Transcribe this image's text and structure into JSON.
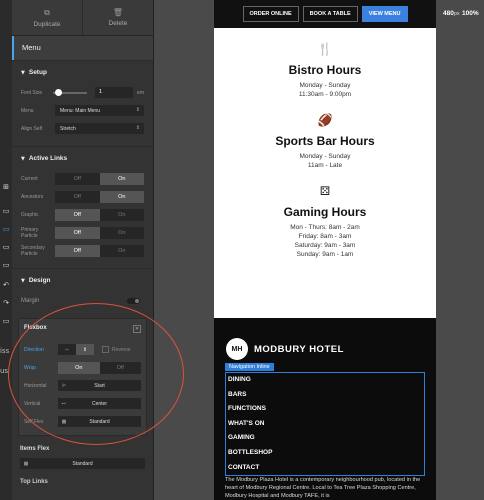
{
  "toolbar": {
    "duplicate": "Duplicate",
    "delete": "Delete"
  },
  "panel_title": "Menu",
  "gutter_texts": [
    "iss",
    "us"
  ],
  "setup": {
    "title": "Setup",
    "font_size_label": "Font Size",
    "font_size_value": "1",
    "font_size_unit": "em",
    "menu_label": "Menu",
    "menu_value": "Menu: Main Menu",
    "align_self_label": "Align Self",
    "align_self_value": "Stretch"
  },
  "active_links": {
    "title": "Active Links",
    "rows": [
      {
        "label": "Current",
        "off": "Off",
        "on": "On",
        "state": "on"
      },
      {
        "label": "Ancestors",
        "off": "Off",
        "on": "On",
        "state": "on"
      },
      {
        "label": "Graphic",
        "off": "Off",
        "on": "On",
        "state": "off"
      },
      {
        "label": "Primary Particle",
        "off": "Off",
        "on": "On",
        "state": "off"
      },
      {
        "label": "Secondary Particle",
        "off": "Off",
        "on": "On",
        "state": "off"
      }
    ]
  },
  "design": {
    "title": "Design",
    "margin_label": "Margin"
  },
  "flexbox": {
    "title": "Flexbox",
    "direction_label": "Direction",
    "reverse_label": "Reverse",
    "wrap_label": "Wrap",
    "wrap_on": "On",
    "wrap_off": "Off",
    "horizontal_label": "Horizontal",
    "horizontal_value": "Start",
    "vertical_label": "Vertical",
    "vertical_value": "Center",
    "self_flex_label": "Self Flex",
    "self_flex_value": "Standard"
  },
  "items_flex": {
    "title": "Items Flex",
    "value": "Standard"
  },
  "top_links": {
    "title": "Top Links"
  },
  "preview": {
    "nav_buttons": [
      "ORDER ONLINE",
      "BOOK A TABLE",
      "VIEW MENU"
    ],
    "sections": [
      {
        "icon": "utensils-icon",
        "glyph": "🍴",
        "title": "Bistro Hours",
        "lines": [
          "Monday - Sunday",
          "11:30am - 9:00pm"
        ]
      },
      {
        "icon": "football-icon",
        "glyph": "🏈",
        "title": "Sports Bar Hours",
        "lines": [
          "Monday - Sunday",
          "11am - Late"
        ]
      },
      {
        "icon": "dice-icon",
        "glyph": "⚄",
        "title": "Gaming Hours",
        "lines": [
          "Mon - Thurs: 8am - 2am",
          "Friday: 8am - 3am",
          "Saturday: 9am - 3am",
          "Sunday: 9am - 1am"
        ]
      }
    ],
    "logo_mark": "MH",
    "logo_text": "MODBURY HOTEL",
    "nav_inline_tag": "Navigation Inline",
    "nav_items": [
      "DINING",
      "BARS",
      "FUNCTIONS",
      "WHAT'S ON",
      "GAMING",
      "BOTTLESHOP",
      "CONTACT"
    ],
    "footer_text": "The Modbury Plaza Hotel is a contemporary neighbourhood pub, located in the heart of Modbury Regional Centre. Local to Tea Tree Plaza Shopping Centre, Modbury Hospital and Modbury TAFE, it is"
  },
  "viewport": {
    "width": "480",
    "unit": "px",
    "zoom": "100%"
  },
  "colors": {
    "accent": "#4aa3e8",
    "annotation": "#d9533f",
    "view_menu": "#3b82e0"
  }
}
